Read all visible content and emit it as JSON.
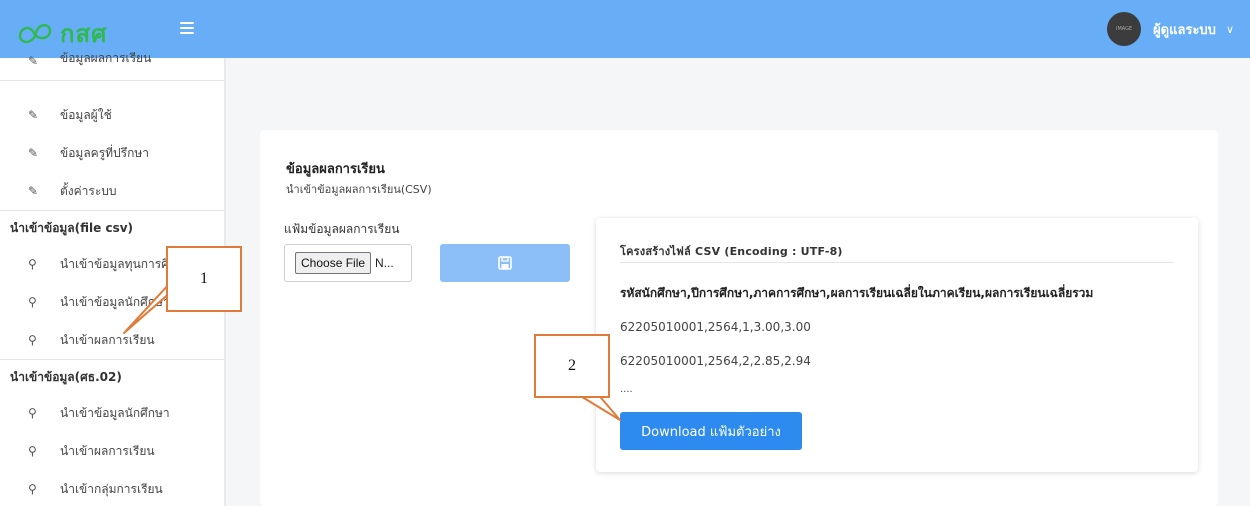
{
  "brand": {
    "name": "กสศ",
    "logo_color": "#2fb94f"
  },
  "topbar": {
    "color": "#67aef6",
    "menu_icon": "hamburger-icon"
  },
  "user": {
    "avatar_text": "IMAGE",
    "name": "ผู้ดูแลระบบ",
    "caret": "∨"
  },
  "sidebar": {
    "top_partial_label": "ข้อมูลผลการเรียน",
    "items": [
      {
        "icon": "edit-icon",
        "label": "ข้อมูลผู้ใช้"
      },
      {
        "icon": "edit-icon",
        "label": "ข้อมูลครูที่ปรึกษา"
      },
      {
        "icon": "edit-icon",
        "label": "ตั้งค่าระบบ"
      }
    ],
    "section_csv": {
      "heading": "นำเข้าข้อมูล(file csv)",
      "items": [
        {
          "icon": "pin-icon",
          "label": "นำเข้าข้อมูลทุนการศึกษา"
        },
        {
          "icon": "pin-icon",
          "label": "นำเข้าข้อมูลนักศึกษา"
        },
        {
          "icon": "pin-icon",
          "label": "นำเข้าผลการเรียน"
        }
      ]
    },
    "section_form": {
      "heading": "นำเข้าข้อมูล(ศธ.02)",
      "items": [
        {
          "icon": "pin-icon",
          "label": "นำเข้าข้อมูลนักศึกษา"
        },
        {
          "icon": "pin-icon",
          "label": "นำเข้าผลการเรียน"
        },
        {
          "icon": "pin-icon",
          "label": "นำเข้ากลุ่มการเรียน"
        }
      ]
    }
  },
  "card": {
    "title": "ข้อมูลผลการเรียน",
    "subtitle": "นำเข้าข้อมูลผลการเรียน(CSV)",
    "file_label": "แฟ้มข้อมูลผลการเรียน",
    "choose_file": "Choose File",
    "file_name": "N...",
    "save_icon": "save-icon"
  },
  "panel": {
    "title": "โครงสร้างไฟล์ CSV (Encoding : UTF-8)",
    "header": "รหัสนักศึกษา,ปีการศึกษา,ภาคการศึกษา,ผลการเรียนเฉลี่ยในภาคเรียน,ผลการเรียนเฉลี่ยรวม",
    "rows": [
      "62205010001,2564,1,3.00,3.00",
      "62205010001,2564,2,2.85,2.94"
    ],
    "ellipsis": "....",
    "download_label": "Download แฟ้มตัวอย่าง"
  },
  "callouts": [
    "1",
    "2"
  ],
  "colors": {
    "primary": "#2d8bf0",
    "disabled": "#8cbff8",
    "callout": "#e07b39"
  }
}
